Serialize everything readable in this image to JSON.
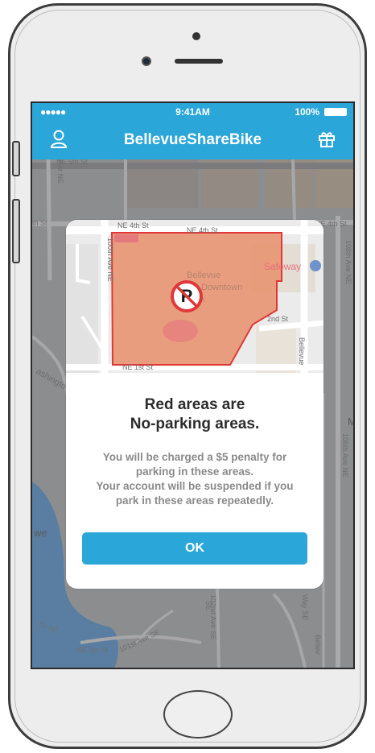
{
  "status_bar": {
    "signal": "●●●●●",
    "time": "9:41AM",
    "battery_percent": "100%"
  },
  "nav": {
    "title": "BellevueShareBike",
    "left_icon": "user-icon",
    "right_icon": "gift-icon"
  },
  "map": {
    "street_labels": {
      "ne_5th": "NE 5th St",
      "ave_98": "98th Ave NE",
      "th_st": "th St",
      "ne_4th_right": "NE 4th St",
      "ave_108": "108th Ave NE",
      "ave_106": "106th Ave NE",
      "washington": "ashingto",
      "we": "we",
      "m": "M",
      "ave_102": "102nd Ave SE",
      "way_se": "Way SE",
      "bellev": "Bellev",
      "se_5th": "SE 5th St",
      "ave_101": "101st Ave SE",
      "dr_se": "Dr SE",
      "se": "SE"
    }
  },
  "modal": {
    "map_labels": {
      "ne_4th_a": "NE 4th St",
      "ne_4th_b": "NE 4th St",
      "ave_100": "100th Ave NE",
      "park_1": "Bellevue",
      "park_2": "Downtown",
      "park_3": "Park",
      "safeway": "Safeway",
      "second_st": "2nd St",
      "bellevue_way": "Bellevue",
      "ne_1st": "NE 1st St"
    },
    "no_parking_icon": "no-parking-icon",
    "title_line1": "Red areas are",
    "title_line2": "No-parking areas.",
    "message_line1": "You will be charged a $5 penalty for",
    "message_line2": "parking in these areas.",
    "message_line3": "Your account will be suspended if you",
    "message_line4": "park in these areas repeatedly.",
    "ok_label": "OK"
  },
  "colors": {
    "brand": "#2aa6d8",
    "no_parking_fill": "#e8906b",
    "no_parking_stroke": "#e0383a"
  }
}
